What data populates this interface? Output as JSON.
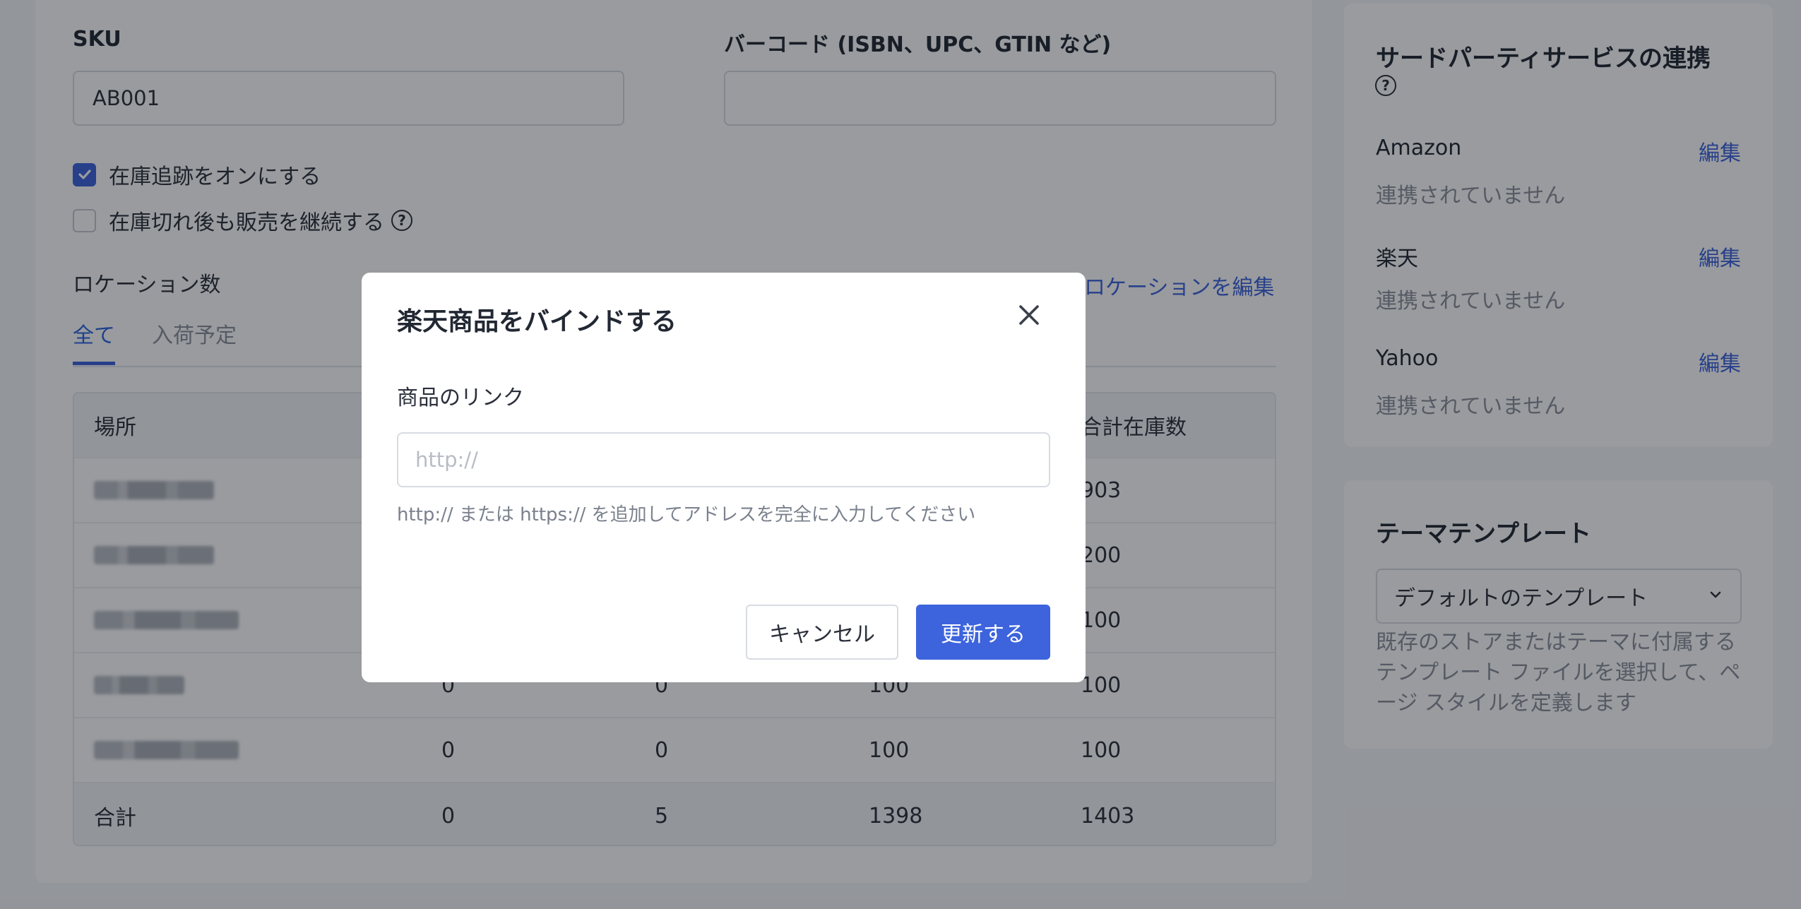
{
  "form": {
    "sku_label": "SKU",
    "sku_value": "AB001",
    "barcode_label": "バーコード (ISBN、UPC、GTIN など)",
    "barcode_value": "",
    "track_inventory_label": "在庫追跡をオンにする",
    "track_inventory_checked": true,
    "continue_selling_label": "在庫切れ後も販売を継続する",
    "continue_selling_checked": false,
    "help_glyph": "?"
  },
  "locations": {
    "title": "ロケーション数",
    "edit_link": "ロケーションを編集",
    "tabs": [
      {
        "label": "全て",
        "active": true
      },
      {
        "label": "入荷予定",
        "active": false
      }
    ],
    "columns": [
      "場所",
      "",
      "",
      "",
      "合計在庫数"
    ],
    "rows": [
      {
        "c1": "",
        "c2": "",
        "c3": "",
        "total": "903"
      },
      {
        "c1": "",
        "c2": "",
        "c3": "",
        "total": "200"
      },
      {
        "c1": "",
        "c2": "",
        "c3": "",
        "total": "100"
      },
      {
        "c1": "0",
        "c2": "0",
        "c3": "100",
        "total": "100"
      },
      {
        "c1": "0",
        "c2": "0",
        "c3": "100",
        "total": "100"
      }
    ],
    "total_row": {
      "label": "合計",
      "c1": "0",
      "c2": "5",
      "c3": "1398",
      "total": "1403"
    }
  },
  "integrations": {
    "title": "サードパーティサービスの連携",
    "help_glyph": "?",
    "edit_label": "編集",
    "status_text": "連携されていません",
    "services": [
      {
        "name": "Amazon"
      },
      {
        "name": "楽天"
      },
      {
        "name": "Yahoo"
      }
    ]
  },
  "theme": {
    "title": "テーマテンプレート",
    "selected": "デフォルトのテンプレート",
    "description": "既存のストアまたはテーマに付属するテンプレート ファイルを選択して、ページ スタイルを定義します"
  },
  "modal": {
    "title": "楽天商品をバインドする",
    "field_label": "商品のリンク",
    "placeholder": "http://",
    "hint": "http:// または https:// を追加してアドレスを完全に入力してください",
    "cancel_label": "キャンセル",
    "submit_label": "更新する"
  },
  "colors": {
    "accent": "#3d63dd",
    "overlay": "rgba(12,16,24,0.42)"
  }
}
